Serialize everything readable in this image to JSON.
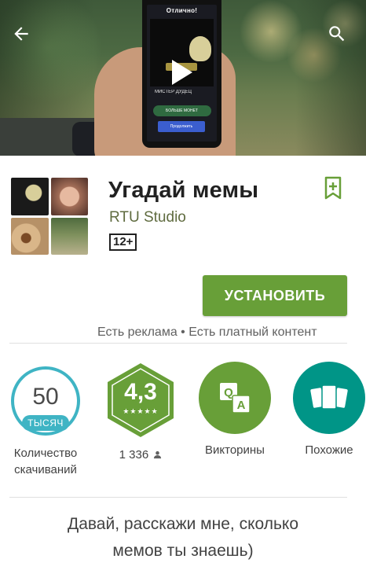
{
  "hero": {
    "phone_title": "Отлично!",
    "phone_label": "МИСТЕР ДУДЕЦ",
    "phone_coins": "БОЛЬШЕ МОНЕТ",
    "phone_cta": "Продолжить"
  },
  "app": {
    "title": "Угадай мемы",
    "developer": "RTU Studio",
    "age_rating": "12+",
    "install_label": "УСТАНОВИТЬ",
    "ads_note": "Есть реклама • Есть платный контент"
  },
  "stats": {
    "downloads_number": "50",
    "downloads_unit": "ТЫСЯЧ",
    "downloads_label_line1": "Количество",
    "downloads_label_line2": "скачиваний",
    "rating_value": "4,3",
    "rating_stars": "★★★★★",
    "reviews_count": "1 336",
    "category_label": "Викторины",
    "similar_label": "Похожие"
  },
  "description": {
    "line1": "Давай, расскажи мне, сколько",
    "line2": "мемов ты знаешь)"
  },
  "colors": {
    "install_green": "#689f38",
    "downloads_teal": "#3fb4c4",
    "similar_teal": "#009587",
    "developer_green": "#5f6b3f"
  },
  "icons": {
    "back": "arrow-left-icon",
    "search": "search-icon",
    "bookmark": "bookmark-add-icon",
    "person": "person-icon",
    "category": "quiz-qa-icon",
    "similar": "cards-icon"
  }
}
